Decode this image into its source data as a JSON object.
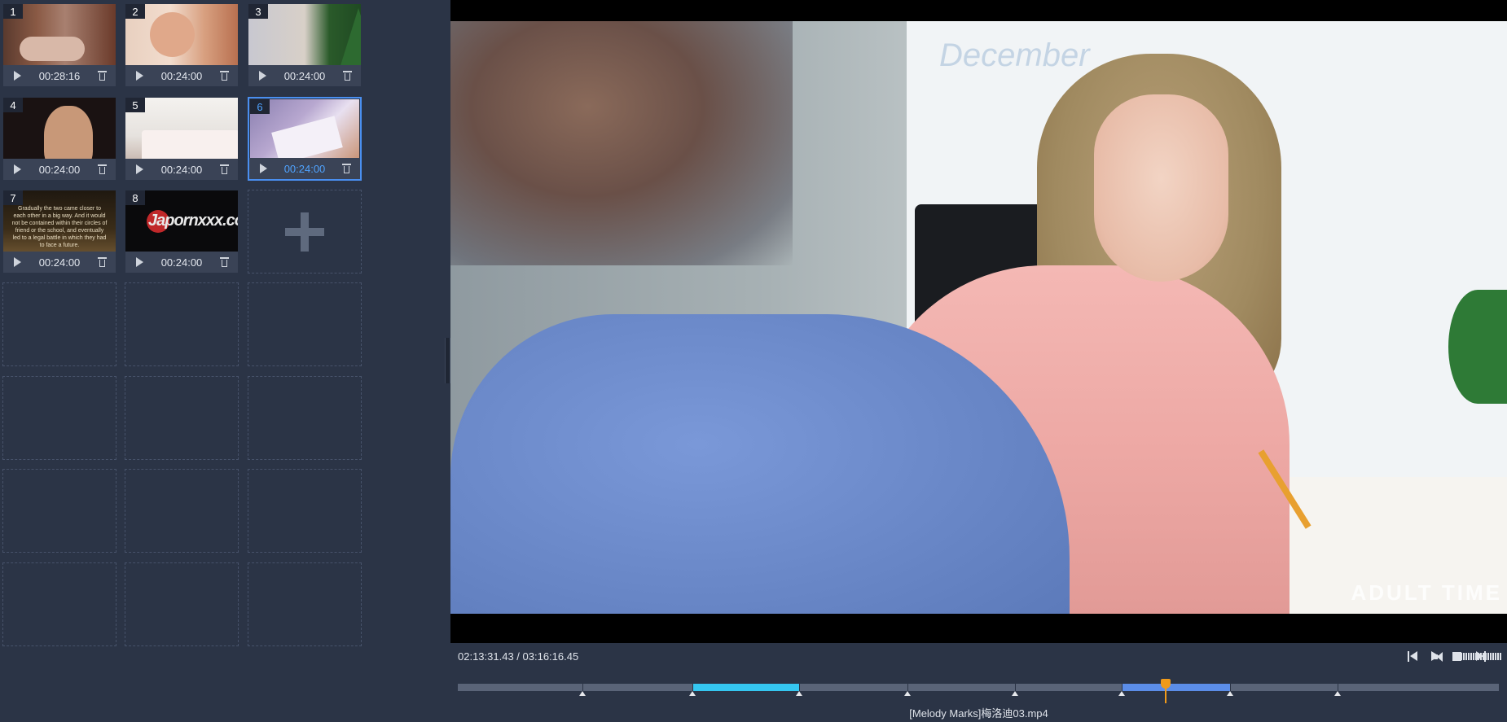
{
  "clips": [
    {
      "num": "1",
      "duration": "00:28:16",
      "selected": false
    },
    {
      "num": "2",
      "duration": "00:24:00",
      "selected": false
    },
    {
      "num": "3",
      "duration": "00:24:00",
      "selected": false
    },
    {
      "num": "4",
      "duration": "00:24:00",
      "selected": false
    },
    {
      "num": "5",
      "duration": "00:24:00",
      "selected": false
    },
    {
      "num": "6",
      "duration": "00:24:00",
      "selected": true
    },
    {
      "num": "7",
      "duration": "00:24:00",
      "selected": false
    },
    {
      "num": "8",
      "duration": "00:24:00",
      "selected": false
    }
  ],
  "thumb7_text": "Gradually the two came closer to each other in a big way. And it would not be contained within their circles of friend or the school, and eventually led to a legal battle in which they had to face a future.",
  "thumb8_logo": "Japornxxx.com",
  "video": {
    "watermark": "ADULT TIME",
    "board_text": "December"
  },
  "transport": {
    "time": "02:13:31.43 / 03:16:16.45",
    "volume_level": 1.0
  },
  "timeline": {
    "filename": "[Melody Marks]梅洛迪03.mp4",
    "playhead_position": 0.68,
    "segment_boundaries": [
      0,
      0.12,
      0.225,
      0.328,
      0.432,
      0.535,
      0.638,
      0.742,
      0.845,
      1.0
    ],
    "highlighted_segments": [
      {
        "index": 2,
        "color": "#35c6f0"
      },
      {
        "index": 6,
        "color": "#5b8de8"
      }
    ]
  },
  "colors": {
    "panel_bg": "#2b3446",
    "selected_border": "#4a8ff0",
    "playhead": "#f09a1a"
  }
}
